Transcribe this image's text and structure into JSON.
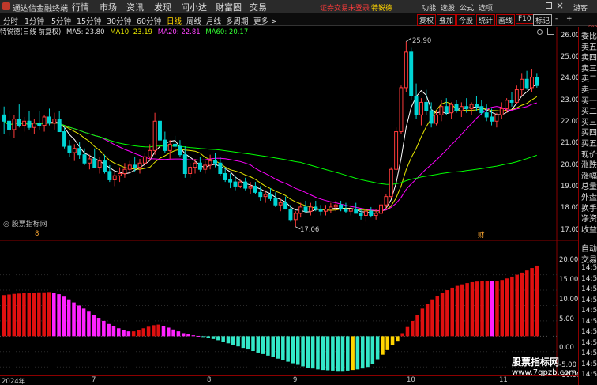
{
  "titlebar": {
    "app_name": "通达信金融终端",
    "menus": [
      "行情",
      "市场",
      "资讯",
      "发现",
      "问小达",
      "财富圈",
      "交易"
    ],
    "login_notice": "证券交易未登录",
    "stock_tag": "特锐德",
    "right_menus": [
      "功能",
      "选股",
      "公式",
      "选项"
    ],
    "guest": "游客"
  },
  "toolbar": {
    "periods": [
      "分时",
      "1分钟",
      "5分钟",
      "15分钟",
      "30分钟",
      "60分钟",
      "日线",
      "周线",
      "月线",
      "多周期",
      "更多 >"
    ],
    "active_period": "日线",
    "right_tools": [
      "复权",
      "叠加",
      "今股",
      "统计",
      "画线",
      "F10",
      "标记",
      "-",
      "+"
    ]
  },
  "legend": {
    "title": "特锐德(日线 前复权)",
    "ma5": "MA5: 23.80",
    "ma10": "MA10: 23.19",
    "ma20": "MA20: 22.81",
    "ma60": "MA60: 20.17"
  },
  "colors": {
    "up": "#ff3b3b",
    "down": "#00d4d4",
    "ma5": "#ffffff",
    "ma10": "#e8e800",
    "ma20": "#ff00ff",
    "ma60": "#00ff00",
    "ind_red": "#e01010",
    "ind_magenta": "#ff22ff",
    "ind_cyan": "#33e8c8",
    "ind_yellow": "#ffd400"
  },
  "price_axis": {
    "ticks": [
      "26.00",
      "25.00",
      "24.00",
      "23.00",
      "22.00",
      "21.00",
      "20.00",
      "19.00",
      "18.00",
      "17.00"
    ],
    "top_value": "500",
    "max_label": "25.90",
    "min_label": "17.06"
  },
  "indicator": {
    "title": "股票指标网",
    "ticks": [
      "20.00",
      "15.00",
      "10.00",
      "5.00",
      "0.00",
      "-5.00",
      "-10.00"
    ]
  },
  "dates": {
    "year": "2024年",
    "labels": [
      "7",
      "8",
      "9",
      "10",
      "11"
    ]
  },
  "markers": {
    "left": "8",
    "cai": "财"
  },
  "sidebar": {
    "labels": [
      "委比",
      "卖五",
      "卖四",
      "卖三",
      "卖二",
      "卖一",
      "买一",
      "买二",
      "买三",
      "买四",
      "买五",
      "现价",
      "涨跌",
      "涨幅",
      "总量",
      "外盘",
      "换手",
      "净资",
      "收益"
    ],
    "lower": [
      "自动",
      "交易"
    ],
    "times": [
      "14:5",
      "14:5",
      "14:5",
      "14:5",
      "14:5",
      "14:5",
      "14:5",
      "14:5",
      "14:5",
      "14:5",
      "14:5"
    ]
  },
  "watermark": {
    "line1": "股票指标网",
    "line2": "www.7gpzb.com"
  },
  "chart_data": {
    "type": "candlestick",
    "ylim": [
      16.6,
      26.3
    ],
    "ohlc": [
      [
        22.4,
        22.8,
        21.5,
        22.1
      ],
      [
        22.1,
        22.6,
        21.4,
        21.7
      ],
      [
        21.7,
        22.4,
        21.3,
        22.2
      ],
      [
        22.2,
        22.9,
        21.8,
        21.9
      ],
      [
        21.9,
        22.3,
        21.6,
        22.1
      ],
      [
        22.1,
        22.6,
        21.7,
        21.8
      ],
      [
        21.8,
        22.2,
        21.5,
        22.0
      ],
      [
        22.0,
        22.6,
        21.7,
        21.9
      ],
      [
        21.9,
        22.4,
        21.6,
        22.3
      ],
      [
        22.3,
        22.7,
        21.9,
        22.0
      ],
      [
        22.0,
        22.5,
        21.7,
        22.2
      ],
      [
        22.2,
        22.6,
        21.7,
        21.6
      ],
      [
        21.6,
        21.8,
        20.8,
        20.9
      ],
      [
        20.9,
        21.2,
        20.4,
        20.6
      ],
      [
        20.6,
        21.0,
        20.2,
        20.8
      ],
      [
        20.8,
        21.1,
        20.3,
        20.5
      ],
      [
        20.5,
        20.8,
        20.0,
        20.1
      ],
      [
        20.1,
        20.5,
        19.8,
        20.3
      ],
      [
        20.3,
        20.8,
        19.9,
        19.9
      ],
      [
        19.9,
        20.4,
        19.6,
        20.2
      ],
      [
        20.2,
        20.5,
        19.6,
        19.7
      ],
      [
        19.7,
        20.0,
        19.2,
        19.3
      ],
      [
        19.3,
        19.7,
        19.0,
        19.5
      ],
      [
        19.5,
        19.9,
        19.2,
        19.6
      ],
      [
        19.6,
        20.1,
        19.4,
        19.8
      ],
      [
        19.8,
        20.2,
        19.6,
        20.0
      ],
      [
        20.0,
        20.4,
        19.7,
        19.9
      ],
      [
        19.9,
        20.3,
        19.6,
        20.1
      ],
      [
        20.1,
        20.6,
        19.9,
        20.4
      ],
      [
        20.4,
        21.0,
        20.2,
        20.7
      ],
      [
        20.7,
        22.5,
        20.5,
        22.1
      ],
      [
        22.1,
        22.4,
        21.0,
        21.2
      ],
      [
        21.2,
        21.6,
        20.6,
        20.7
      ],
      [
        20.7,
        21.2,
        20.3,
        21.0
      ],
      [
        21.0,
        21.4,
        20.8,
        20.9
      ],
      [
        20.9,
        21.2,
        20.4,
        20.5
      ],
      [
        20.5,
        20.9,
        19.4,
        19.6
      ],
      [
        19.6,
        20.1,
        19.4,
        19.9
      ],
      [
        19.9,
        20.3,
        19.6,
        20.1
      ],
      [
        20.1,
        20.4,
        19.7,
        19.8
      ],
      [
        19.8,
        20.2,
        19.6,
        20.0
      ],
      [
        20.0,
        20.5,
        19.8,
        20.2
      ],
      [
        20.2,
        20.6,
        19.9,
        20.1
      ],
      [
        20.1,
        20.4,
        19.5,
        19.6
      ],
      [
        19.6,
        19.9,
        19.2,
        19.3
      ],
      [
        19.3,
        19.6,
        18.9,
        19.2
      ],
      [
        19.2,
        19.5,
        18.8,
        19.0
      ],
      [
        19.0,
        19.3,
        18.9,
        19.2
      ],
      [
        19.2,
        19.4,
        18.8,
        18.9
      ],
      [
        18.9,
        19.2,
        18.6,
        19.0
      ],
      [
        19.0,
        19.2,
        18.6,
        18.7
      ],
      [
        18.7,
        19.0,
        18.3,
        18.5
      ],
      [
        18.5,
        18.8,
        18.2,
        18.6
      ],
      [
        18.6,
        18.9,
        18.3,
        18.4
      ],
      [
        18.4,
        18.7,
        18.0,
        18.1
      ],
      [
        18.1,
        18.4,
        17.8,
        18.2
      ],
      [
        18.2,
        18.5,
        17.9,
        17.9
      ],
      [
        17.9,
        18.1,
        17.3,
        17.4
      ],
      [
        17.4,
        17.8,
        17.06,
        17.7
      ],
      [
        17.7,
        18.2,
        17.5,
        18.0
      ],
      [
        18.0,
        18.3,
        17.7,
        17.8
      ],
      [
        17.8,
        18.2,
        17.6,
        18.0
      ],
      [
        18.0,
        18.3,
        17.8,
        17.9
      ],
      [
        17.9,
        18.1,
        17.6,
        17.8
      ],
      [
        17.8,
        18.1,
        17.6,
        17.9
      ],
      [
        17.9,
        18.2,
        17.7,
        18.0
      ],
      [
        18.0,
        18.3,
        17.8,
        18.1
      ],
      [
        18.1,
        18.3,
        17.8,
        17.9
      ],
      [
        17.9,
        18.2,
        17.7,
        17.8
      ],
      [
        17.8,
        18.1,
        17.6,
        17.9
      ],
      [
        17.9,
        18.2,
        17.7,
        17.7
      ],
      [
        17.7,
        17.9,
        17.4,
        17.6
      ],
      [
        17.6,
        17.9,
        17.3,
        17.8
      ],
      [
        17.8,
        18.0,
        17.5,
        17.6
      ],
      [
        17.6,
        17.9,
        17.4,
        17.7
      ],
      [
        17.7,
        18.3,
        17.6,
        18.1
      ],
      [
        18.1,
        18.6,
        17.9,
        18.5
      ],
      [
        18.5,
        19.9,
        18.4,
        19.8
      ],
      [
        19.8,
        21.8,
        19.7,
        21.6
      ],
      [
        21.6,
        23.8,
        21.5,
        23.7
      ],
      [
        23.7,
        25.9,
        23.5,
        25.4
      ],
      [
        25.4,
        25.6,
        23.1,
        23.3
      ],
      [
        23.3,
        23.9,
        22.2,
        22.4
      ],
      [
        22.4,
        23.2,
        21.9,
        23.0
      ],
      [
        23.0,
        23.6,
        22.4,
        22.6
      ],
      [
        22.6,
        23.0,
        21.8,
        22.0
      ],
      [
        22.0,
        22.6,
        21.9,
        22.4
      ],
      [
        22.4,
        23.1,
        22.1,
        22.8
      ],
      [
        22.8,
        23.2,
        22.4,
        22.5
      ],
      [
        22.5,
        23.0,
        22.2,
        22.9
      ],
      [
        22.9,
        23.1,
        22.5,
        22.6
      ],
      [
        22.6,
        23.0,
        22.3,
        22.8
      ],
      [
        22.8,
        23.2,
        22.5,
        22.7
      ],
      [
        22.7,
        23.0,
        22.4,
        22.9
      ],
      [
        22.9,
        23.3,
        22.6,
        22.8
      ],
      [
        22.8,
        23.1,
        22.4,
        22.5
      ],
      [
        22.5,
        22.9,
        22.1,
        22.3
      ],
      [
        22.3,
        22.7,
        21.9,
        22.1
      ],
      [
        22.1,
        22.5,
        21.8,
        22.4
      ],
      [
        22.4,
        23.0,
        22.2,
        22.7
      ],
      [
        22.7,
        23.2,
        22.5,
        23.1
      ],
      [
        23.1,
        23.5,
        22.8,
        23.0
      ],
      [
        23.0,
        23.8,
        22.9,
        23.6
      ],
      [
        23.6,
        24.4,
        23.3,
        24.1
      ],
      [
        24.1,
        24.5,
        23.6,
        23.7
      ],
      [
        23.7,
        24.6,
        23.5,
        24.2
      ],
      [
        24.2,
        24.4,
        23.7,
        23.8
      ]
    ],
    "indicator_values": [
      13.4,
      13.6,
      13.8,
      13.9,
      14.0,
      14.1,
      14.2,
      14.3,
      14.3,
      14.4,
      14.2,
      13.7,
      12.9,
      12.0,
      11.0,
      10.0,
      9.0,
      8.0,
      7.0,
      6.0,
      5.0,
      4.0,
      3.2,
      2.6,
      2.1,
      1.6,
      1.6,
      2.1,
      2.6,
      3.1,
      3.6,
      3.8,
      3.4,
      2.8,
      2.2,
      1.6,
      1.0,
      0.6,
      0.3,
      0.1,
      -0.2,
      -0.5,
      -0.9,
      -1.3,
      -1.8,
      -2.3,
      -2.8,
      -3.3,
      -3.8,
      -4.3,
      -4.8,
      -5.3,
      -5.8,
      -6.3,
      -6.8,
      -7.3,
      -7.8,
      -8.3,
      -8.8,
      -9.3,
      -9.8,
      -10.2,
      -10.5,
      -10.8,
      -11.0,
      -11.1,
      -11.2,
      -11.3,
      -11.3,
      -11.2,
      -11.0,
      -10.8,
      -10.5,
      -10.0,
      -9.0,
      -7.5,
      -6.0,
      -4.5,
      -3.0,
      -1.5,
      1.0,
      3.0,
      5.0,
      7.0,
      9.0,
      10.5,
      12.0,
      13.0,
      14.0,
      15.0,
      15.8,
      16.4,
      16.9,
      17.3,
      17.6,
      17.8,
      17.9,
      18.0,
      18.0,
      18.0,
      18.3,
      18.8,
      19.4,
      20.0,
      20.7,
      21.4,
      22.2,
      23.0
    ],
    "indicator_colors": [
      "r",
      "r",
      "r",
      "r",
      "r",
      "r",
      "r",
      "r",
      "r",
      "r",
      "m",
      "m",
      "m",
      "m",
      "m",
      "m",
      "m",
      "m",
      "m",
      "m",
      "m",
      "m",
      "m",
      "m",
      "m",
      "m",
      "r",
      "r",
      "r",
      "r",
      "r",
      "r",
      "m",
      "m",
      "m",
      "m",
      "m",
      "m",
      "m",
      "m",
      "c",
      "c",
      "c",
      "c",
      "c",
      "c",
      "c",
      "c",
      "c",
      "c",
      "c",
      "c",
      "c",
      "c",
      "c",
      "c",
      "c",
      "c",
      "c",
      "c",
      "c",
      "c",
      "c",
      "c",
      "c",
      "c",
      "c",
      "c",
      "c",
      "c",
      "y",
      "c",
      "c",
      "c",
      "c",
      "c",
      "y",
      "y",
      "y",
      "y",
      "r",
      "r",
      "r",
      "r",
      "r",
      "r",
      "r",
      "r",
      "r",
      "r",
      "r",
      "r",
      "r",
      "r",
      "r",
      "r",
      "r",
      "r",
      "m",
      "r",
      "r",
      "r",
      "r",
      "r",
      "r",
      "r",
      "r",
      "r"
    ],
    "ind_ylim": [
      -12,
      23.5
    ]
  }
}
